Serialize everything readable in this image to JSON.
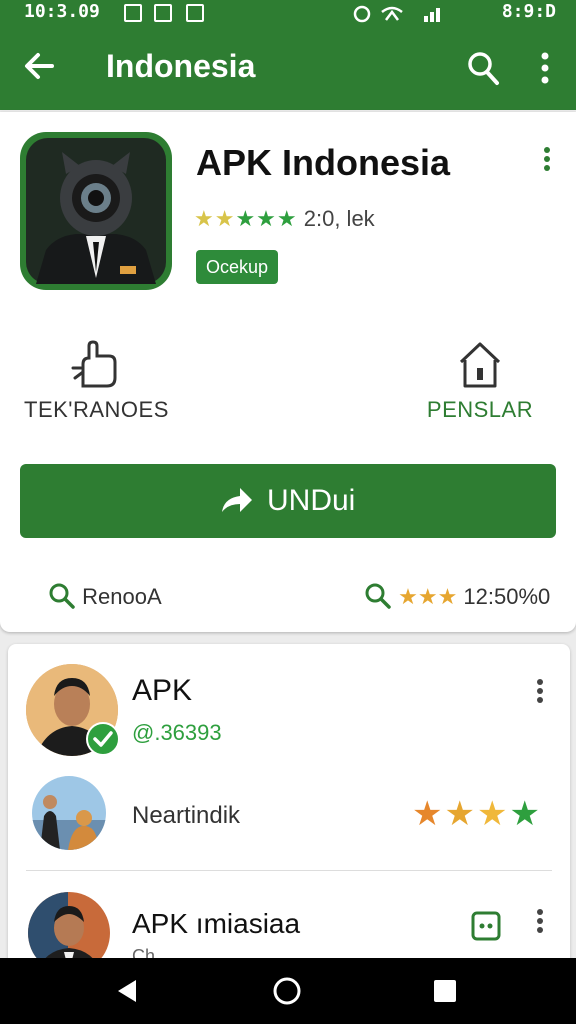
{
  "status": {
    "time": "10:3.09",
    "battery_text": "8:9:D"
  },
  "appbar": {
    "title": "Indonesia"
  },
  "app": {
    "name": "APK Indonesia",
    "rating_text": "2:0, lek",
    "badge": "Ocekup"
  },
  "actions": {
    "left_label": "TEK'RANOES",
    "right_label": "PENSLAR"
  },
  "install": {
    "label": "UNDui"
  },
  "bottom": {
    "left_label": "RenooA",
    "right_value": "12:50%0"
  },
  "list": [
    {
      "title": "APK",
      "subtitle": "@.36393",
      "verified": true
    },
    {
      "text": "Neartindik",
      "stars": 4
    },
    {
      "title": "APK ımiasiaa",
      "subtitle": "Ch..."
    }
  ],
  "colors": {
    "brand": "#2e7d32",
    "accent": "#2e9f3e",
    "star": "#e6a630"
  },
  "icons": [
    "arrow-back-icon",
    "search-icon",
    "more-vert-icon",
    "hand-share-icon",
    "home-icon",
    "arrow-forward-icon",
    "chat-icon",
    "android-back-icon",
    "android-home-icon",
    "android-recents-icon"
  ]
}
